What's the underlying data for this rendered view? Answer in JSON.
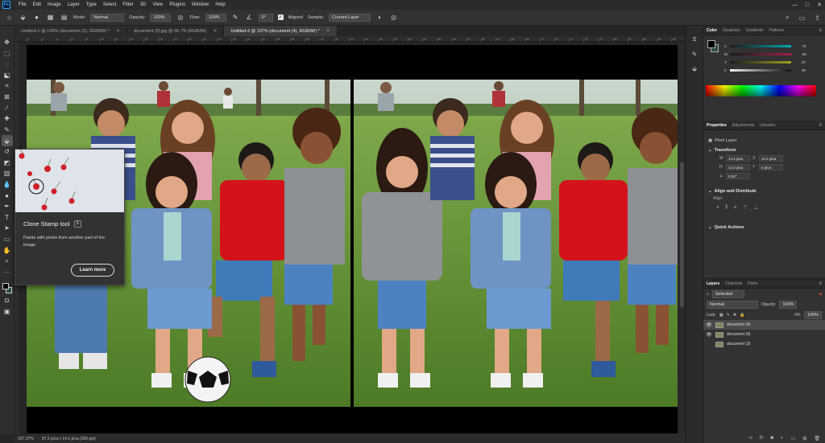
{
  "app": {
    "logo": "Ps"
  },
  "menu": [
    "File",
    "Edit",
    "Image",
    "Layer",
    "Type",
    "Select",
    "Filter",
    "3D",
    "View",
    "Plugins",
    "Window",
    "Help"
  ],
  "options": {
    "mode_label": "Mode:",
    "mode_value": "Normal",
    "opacity_label": "Opacity:",
    "opacity_value": "100%",
    "flow_label": "Flow:",
    "flow_value": "100%",
    "angle_value": "0°",
    "aligned_label": "Aligned",
    "sample_label": "Sample:",
    "sample_value": "Current Layer"
  },
  "tabs": [
    {
      "label": "Untitled-1 @ 143% (document (2), RGB/8#) *"
    },
    {
      "label": "document (3).jpg @ 66.7% (RGB/8#)"
    },
    {
      "label": "Untitled-2 @ 107% (document (4), RGB/8#) *",
      "active": true
    }
  ],
  "ruler_ticks": [
    "0",
    "2",
    "4",
    "6",
    "8",
    "10",
    "12",
    "14",
    "16",
    "18",
    "20",
    "22",
    "24",
    "26",
    "28",
    "30",
    "32",
    "34",
    "36",
    "38",
    "40",
    "42",
    "44",
    "46",
    "48",
    "50",
    "52",
    "54",
    "56",
    "58",
    "60",
    "62",
    "64",
    "66",
    "68",
    "70",
    "72",
    "74",
    "76",
    "78",
    "80",
    "82",
    "84",
    "86",
    "88"
  ],
  "tooltip": {
    "title": "Clone Stamp tool",
    "shortcut": "S",
    "description": "Paints with pixels from another part of the image",
    "button": "Learn more"
  },
  "status": {
    "zoom": "107.37%",
    "doc_size": "37.2 pica x 14.2 pica (300 ppi)"
  },
  "panels": {
    "color_tabs": [
      "Color",
      "Swatches",
      "Gradients",
      "Patterns"
    ],
    "color_values": {
      "c": "75",
      "m": "68",
      "y": "67",
      "k": "90"
    },
    "properties_tabs": [
      "Properties",
      "Adjustments",
      "Libraries"
    ],
    "pixel_layer": "Pixel Layer",
    "transform_label": "Transform",
    "w": "14.2 pica",
    "x": "14.2 pica",
    "h": "14.2 pica",
    "y": "0 pica",
    "angle": "0.00°",
    "align_label": "Align and Distribute",
    "align_sub": "Align:",
    "quick_actions": "Quick Actions",
    "layers_tabs": [
      "Layers",
      "Channels",
      "Paths"
    ],
    "kind": "Selected",
    "blend": "Normal",
    "opacity_label": "Opacity:",
    "opacity": "100%",
    "lock_label": "Lock:",
    "fill_label": "Fill:",
    "fill": "100%",
    "layers": [
      {
        "name": "document (4)",
        "visible": true,
        "selected": true
      },
      {
        "name": "document (4)",
        "visible": true,
        "selected": false
      },
      {
        "name": "document (3)",
        "visible": false,
        "selected": false
      }
    ]
  },
  "colors": {
    "accent": "#31a8ff",
    "bg_swatch": "#2b4d46",
    "grass": "#5f8f32",
    "red_shirt": "#d4121c"
  }
}
